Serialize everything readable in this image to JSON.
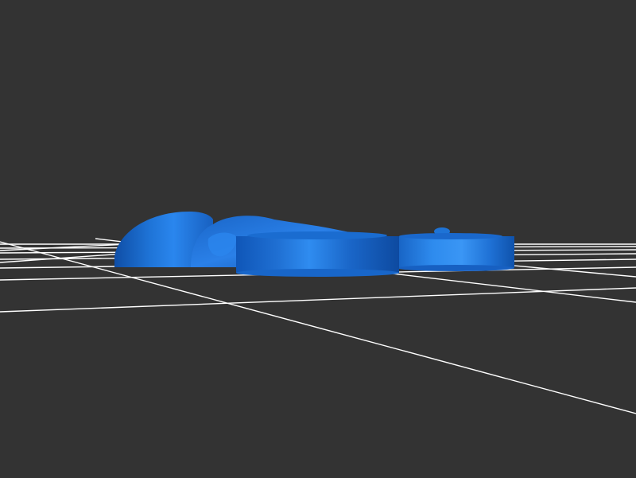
{
  "viewport": {
    "background_color": "#333333",
    "grid_color": "#ffffff",
    "model_color": "#1e73d6",
    "model_highlight_color": "#3a96f5",
    "model_shadow_color": "#0f4ea6"
  }
}
